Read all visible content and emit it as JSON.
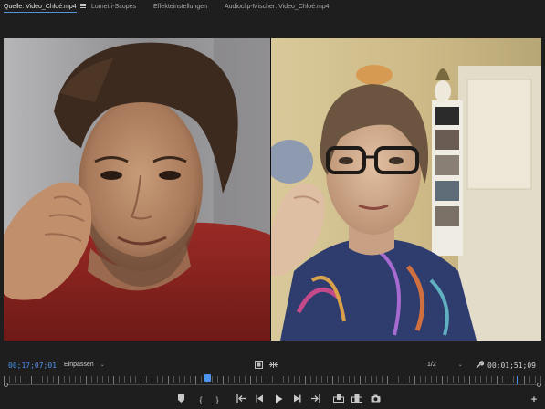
{
  "tabs": [
    {
      "label": "Quelle: Video_Chloé.mp4",
      "active": true
    },
    {
      "label": "Lumetri-Scopes",
      "active": false
    },
    {
      "label": "Effekteinstellungen",
      "active": false
    },
    {
      "label": "Audioclip-Mischer: Video_Chloé.mp4",
      "active": false
    }
  ],
  "controls": {
    "current_timecode": "00;17;07;01",
    "duration_timecode": "00;01;51;09",
    "fit_label": "Einpassen",
    "resolution_label": "1/2",
    "playhead_fraction": 0.378
  },
  "icons": {
    "tab_menu": "hamburger-menu-icon",
    "safe_margins": "safe-margins-icon",
    "drop_frame": "compare-icon",
    "settings": "wrench-icon",
    "add": "plus-icon"
  },
  "transport": [
    {
      "name": "add-marker-button",
      "glyph": "♥"
    },
    {
      "name": "mark-in-button",
      "glyph": "{"
    },
    {
      "name": "mark-out-button",
      "glyph": "}"
    },
    {
      "name": "go-to-in-button",
      "glyph": "{←"
    },
    {
      "name": "step-back-button",
      "glyph": "◀|"
    },
    {
      "name": "play-button",
      "glyph": "▶"
    },
    {
      "name": "step-forward-button",
      "glyph": "|▶"
    },
    {
      "name": "go-to-out-button",
      "glyph": "→}"
    },
    {
      "name": "insert-button",
      "glyph": "⊞"
    },
    {
      "name": "overwrite-button",
      "glyph": "⊟"
    },
    {
      "name": "export-frame-button",
      "glyph": "◉"
    }
  ],
  "colors": {
    "accent": "#4d94ee",
    "background": "#1e1e1e"
  }
}
